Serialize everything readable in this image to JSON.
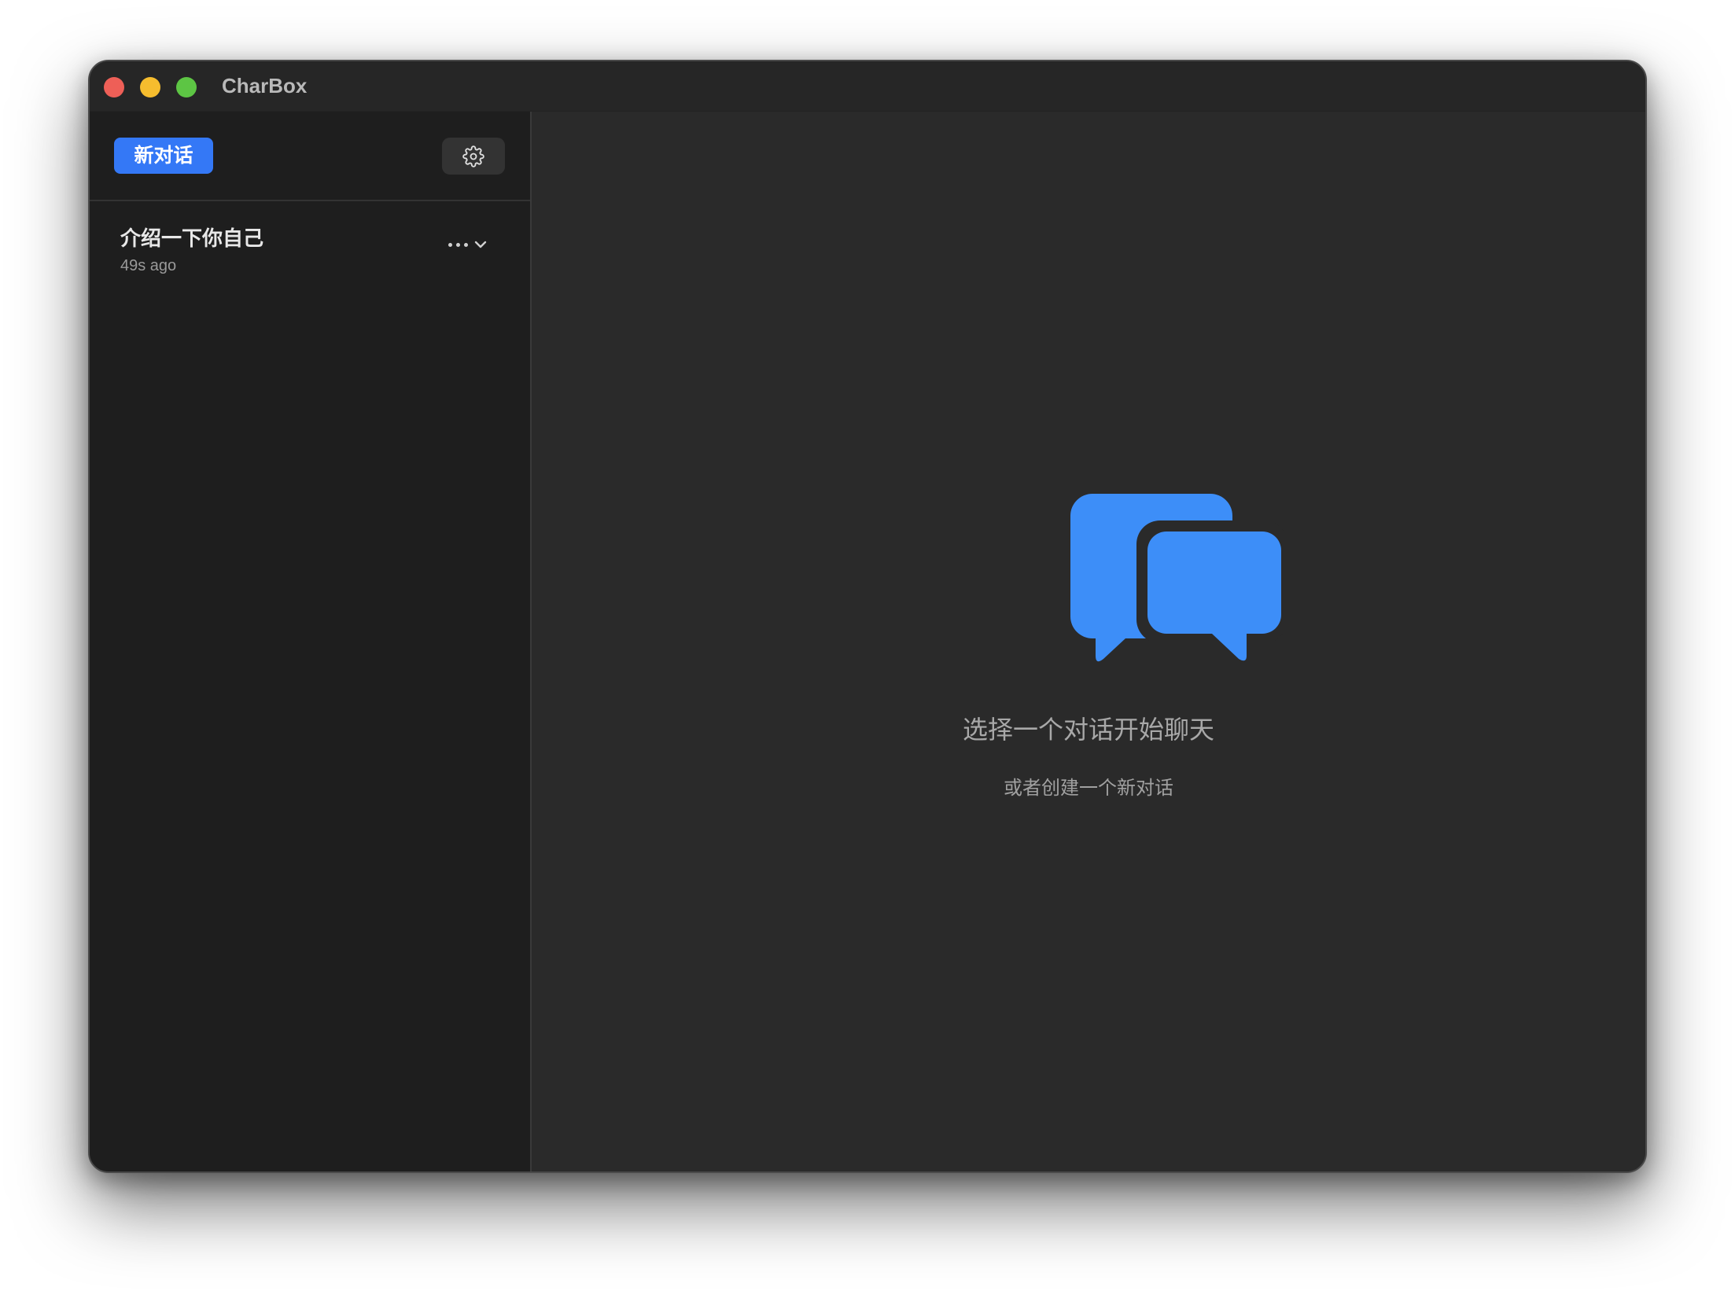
{
  "window": {
    "title": "CharBox"
  },
  "sidebar": {
    "new_chat_label": "新对话",
    "settings_icon": "gear-icon",
    "conversations": [
      {
        "title": "介绍一下你自己",
        "time": "49s ago"
      }
    ]
  },
  "main": {
    "empty_icon": "chat-bubbles-icon",
    "empty_title": "选择一个对话开始聊天",
    "empty_subtitle": "或者创建一个新对话"
  },
  "colors": {
    "accent": "#3478f6",
    "icon_blue": "#3d8ef8",
    "sidebar_bg": "#1e1e1e",
    "main_bg": "#2a2a2a",
    "close": "#ee5f57",
    "minimize": "#f6bd2e",
    "maximize": "#5dc544"
  }
}
